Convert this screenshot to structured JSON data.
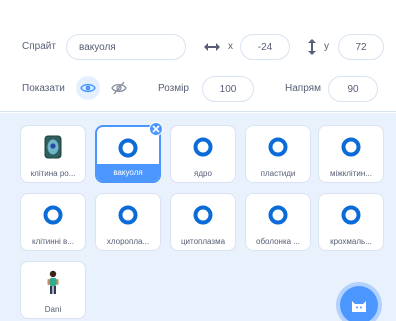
{
  "sprite_info": {
    "sprite_label": "Спрайт",
    "sprite_name": "вакуоля",
    "x_label": "x",
    "x_value": "-24",
    "y_label": "y",
    "y_value": "72",
    "show_label": "Показати",
    "size_label": "Розмір",
    "size_value": "100",
    "direction_label": "Напрям",
    "direction_value": "90"
  },
  "sprites": [
    {
      "name": "клітина ро...",
      "icon": "cell-icon",
      "selected": false
    },
    {
      "name": "вакуоля",
      "icon": "circle-icon",
      "selected": true
    },
    {
      "name": "ядро",
      "icon": "circle-icon",
      "selected": false
    },
    {
      "name": "пластиди",
      "icon": "circle-icon",
      "selected": false
    },
    {
      "name": "міжклітин...",
      "icon": "circle-icon",
      "selected": false
    },
    {
      "name": "клітинні в...",
      "icon": "circle-icon",
      "selected": false
    },
    {
      "name": "хлоропла...",
      "icon": "circle-icon",
      "selected": false
    },
    {
      "name": "цитоплазма",
      "icon": "circle-icon",
      "selected": false
    },
    {
      "name": "оболонка ...",
      "icon": "circle-icon",
      "selected": false
    },
    {
      "name": "крохмаль...",
      "icon": "circle-icon",
      "selected": false
    },
    {
      "name": "Dani",
      "icon": "person-icon",
      "selected": false
    }
  ],
  "colors": {
    "accent": "#4c97ff",
    "pane_bg": "#e9f1fc",
    "text": "#575e75",
    "circle_sprite": "#0b6bd8"
  }
}
